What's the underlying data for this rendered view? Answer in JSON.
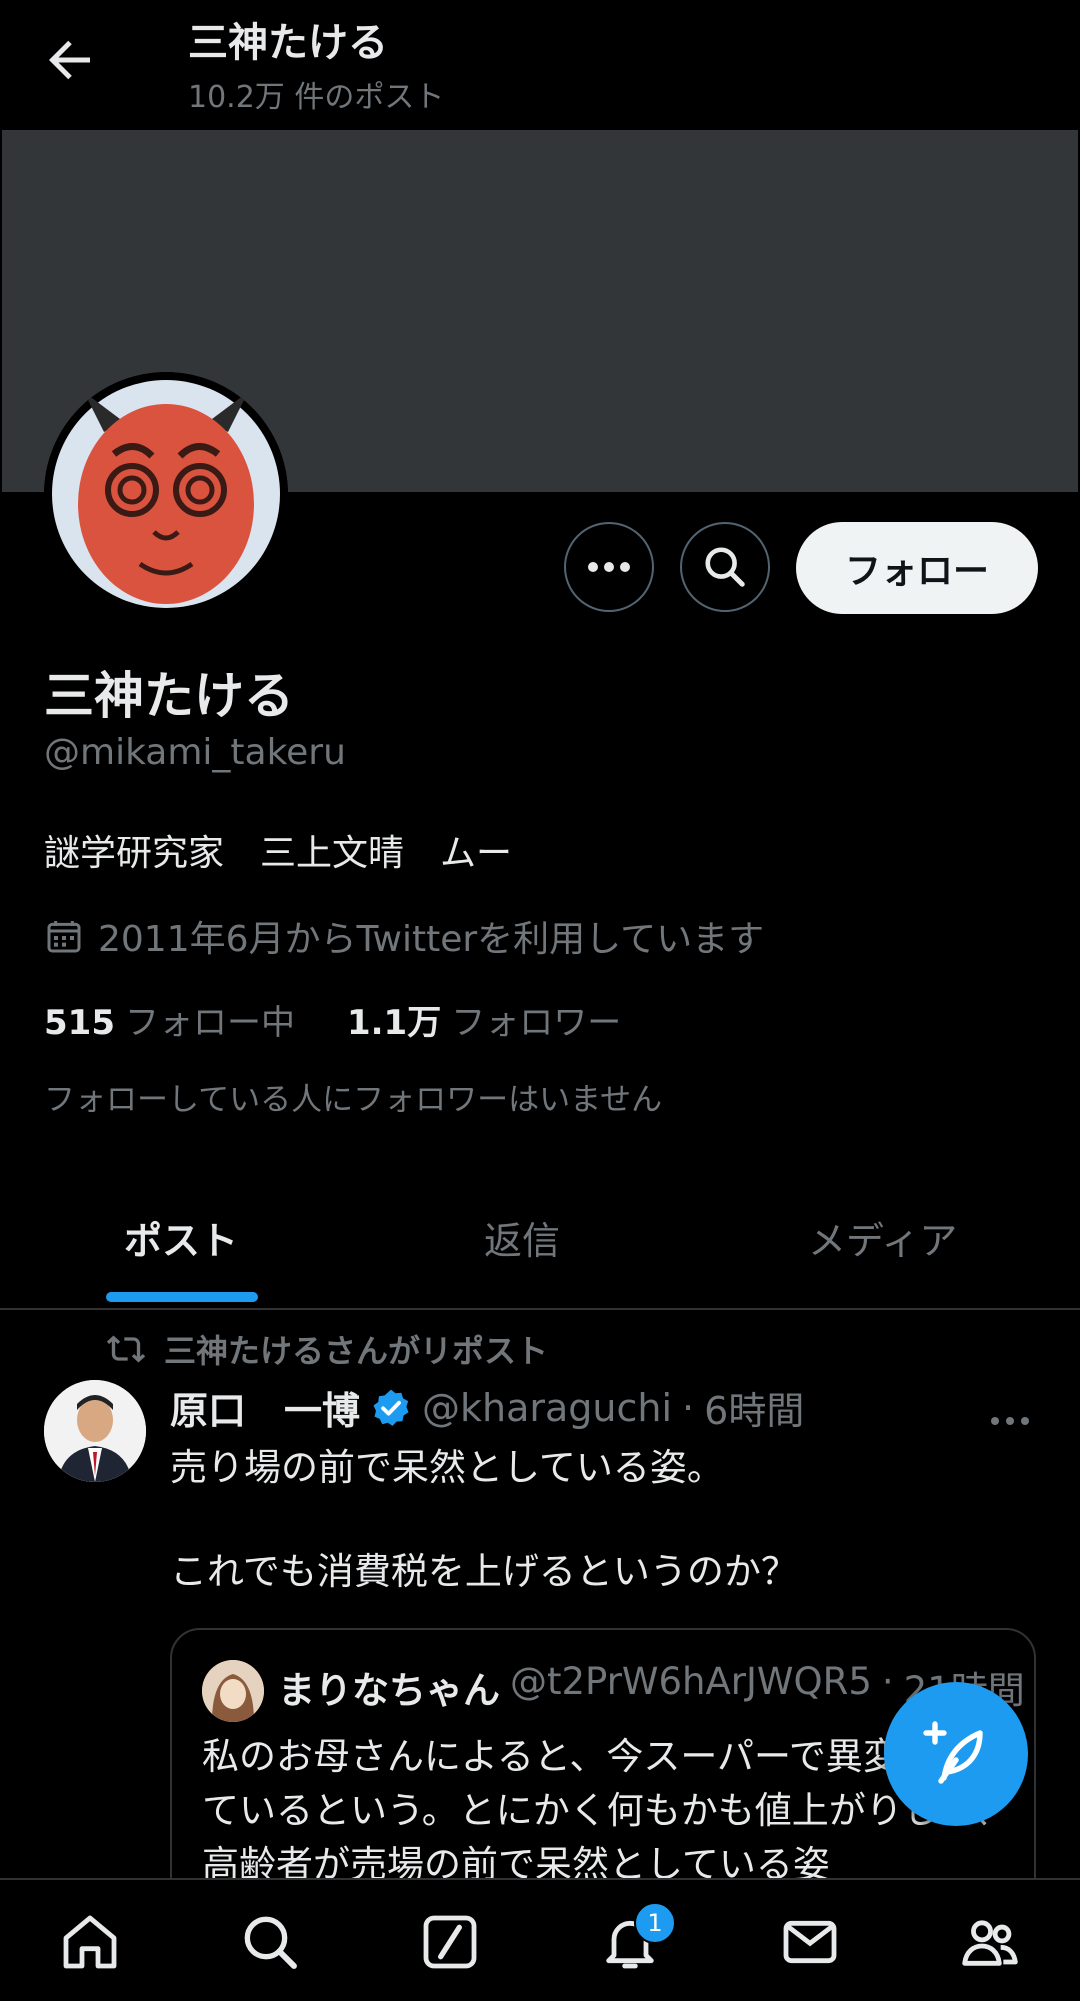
{
  "header": {
    "title": "三神たける",
    "post_count": "10.2万 件のポスト"
  },
  "profile": {
    "follow_label": "フォロー",
    "name": "三神たける",
    "handle": "@mikami_takeru",
    "bio": "謎学研究家　三上文晴　ムー",
    "joined": "2011年6月からTwitterを利用しています",
    "following_count": "515",
    "following_label": "フォロー中",
    "followers_count": "1.1万",
    "followers_label": "フォロワー",
    "no_common_followers": "フォローしている人にフォロワーはいません"
  },
  "tabs": [
    {
      "label": "ポスト",
      "active": true
    },
    {
      "label": "返信",
      "active": false
    },
    {
      "label": "メディア",
      "active": false
    }
  ],
  "tweet": {
    "repost_label": "三神たけるさんがリポスト",
    "author_name": "原口　一博",
    "author_handle": "@kharaguchi",
    "time": "6時間",
    "text": "売り場の前で呆然としている姿。\n\nこれでも消費税を上げるというのか？",
    "quote": {
      "author_name": "まりなちゃん",
      "author_handle": "@t2PrW6hArJWQR5",
      "time": "21時間",
      "text": "私のお母さんによると、今スーパーで異変が起きているという。とにかく何もかも値上がりして、高齢者が売場の前で呆然としている姿"
    }
  },
  "notifications_badge": "1",
  "icons": {
    "back": "arrow-left-icon",
    "more": "more-icon",
    "search": "search-icon",
    "calendar": "calendar-icon",
    "repost": "repost-icon",
    "verified": "verified-badge-icon",
    "compose": "compose-icon",
    "home": "home-icon",
    "grok": "grok-icon",
    "notifications": "bell-icon",
    "messages": "mail-icon",
    "communities": "communities-icon"
  },
  "colors": {
    "accent": "#1d9bf0",
    "background": "#000000",
    "banner": "#333639",
    "muted": "#71767b"
  }
}
